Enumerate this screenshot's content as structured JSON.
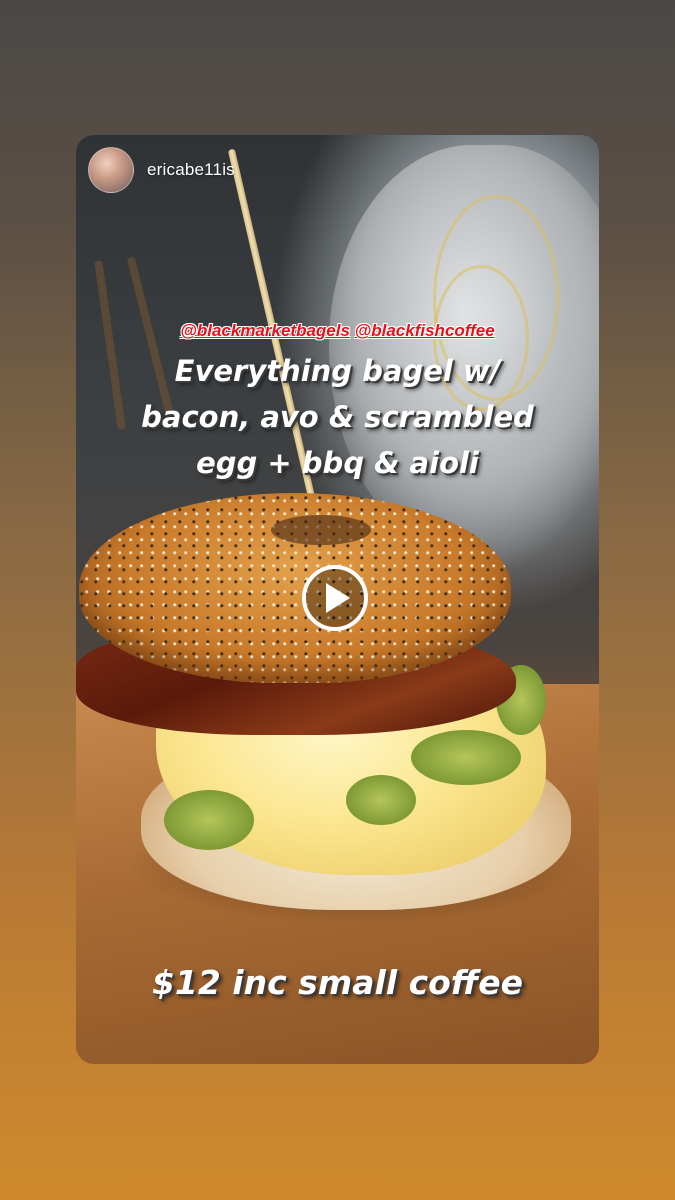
{
  "story": {
    "username": "ericabe11is",
    "mentions": [
      "@blackmarketbagels",
      "@blackfishcoffee"
    ],
    "caption_lines": [
      "Everything bagel w/",
      "bacon, avo & scrambled",
      "egg + bbq & aioli"
    ],
    "price_text": "$12 inc small coffee",
    "play_icon": "play-icon"
  },
  "colors": {
    "mention": "#e8111b",
    "text": "#ffffff",
    "background_top": "#4a4847",
    "background_bottom": "#d08a2c"
  }
}
